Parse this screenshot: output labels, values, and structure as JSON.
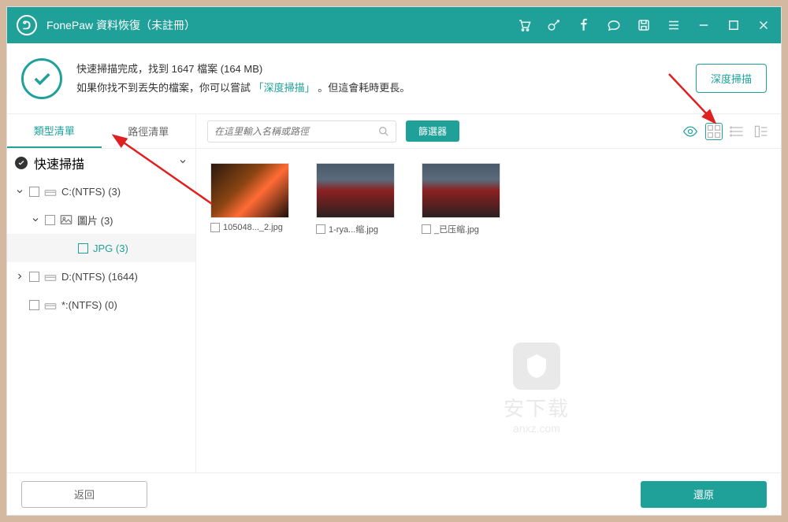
{
  "titlebar": {
    "title": "FonePaw 資料恢復（未註冊）"
  },
  "info": {
    "line1": "快速掃描完成，找到 1647 檔案 (164 MB)",
    "line2_a": "如果你找不到丟失的檔案，你可以嘗試",
    "line2_link": "「深度掃描」",
    "line2_b": "。但這會耗時更長。",
    "deep_scan_btn": "深度掃描"
  },
  "sidebar": {
    "tabs": {
      "type": "類型清單",
      "path": "路徑清單"
    },
    "quick_scan": "快速掃描",
    "tree": {
      "c": "C:(NTFS) (3)",
      "images": "圖片 (3)",
      "jpg": "JPG (3)",
      "d": "D:(NTFS) (1644)",
      "star": "*:(NTFS) (0)"
    }
  },
  "toolbar": {
    "search_placeholder": "在這里輸入名稱或路徑",
    "filter": "篩選器"
  },
  "files": [
    {
      "name": "105048..._2.jpg"
    },
    {
      "name": "1-rya...缩.jpg"
    },
    {
      "name": "_已压缩.jpg"
    }
  ],
  "footer": {
    "back": "返回",
    "recover": "還原"
  },
  "watermark": {
    "text": "安下载",
    "sub": "anxz.com"
  }
}
